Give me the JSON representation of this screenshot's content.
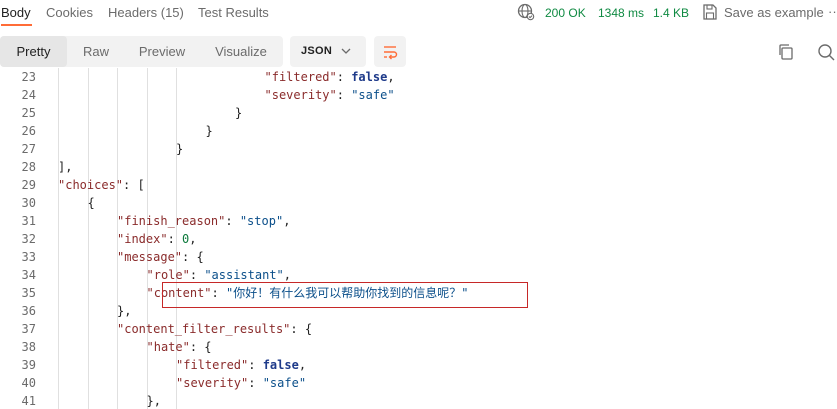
{
  "tabs": [
    {
      "label": "Body",
      "active": true
    },
    {
      "label": "Cookies",
      "active": false
    },
    {
      "label": "Headers (15)",
      "active": false
    },
    {
      "label": "Test Results",
      "active": false
    }
  ],
  "status": {
    "code": "200 OK",
    "time": "1348 ms",
    "size": "1.4 KB",
    "save_label": "Save as example",
    "more": "··"
  },
  "view_modes": [
    {
      "label": "Pretty",
      "active": true
    },
    {
      "label": "Raw",
      "active": false
    },
    {
      "label": "Preview",
      "active": false
    },
    {
      "label": "Visualize",
      "active": false
    }
  ],
  "format": "JSON",
  "colors": {
    "accent": "#ff6c37",
    "status_ok": "#0f8a42",
    "highlight_box": "#c62828"
  },
  "icons": [
    "globe-icon",
    "save-icon",
    "chevron-down-icon",
    "wrap-lines-icon",
    "copy-icon",
    "search-icon"
  ],
  "code_lines": [
    {
      "num": "23",
      "tokens": [
        {
          "t": "k",
          "v": "\"filtered\""
        },
        {
          "t": "p",
          "v": ": "
        },
        {
          "t": "b",
          "v": "false"
        },
        {
          "t": "p",
          "v": ","
        }
      ],
      "indent": 7
    },
    {
      "num": "24",
      "tokens": [
        {
          "t": "k",
          "v": "\"severity\""
        },
        {
          "t": "p",
          "v": ": "
        },
        {
          "t": "s",
          "v": "\"safe\""
        }
      ],
      "indent": 7
    },
    {
      "num": "25",
      "tokens": [
        {
          "t": "p",
          "v": "}"
        }
      ],
      "indent": 6
    },
    {
      "num": "26",
      "tokens": [
        {
          "t": "p",
          "v": "}"
        }
      ],
      "indent": 5
    },
    {
      "num": "27",
      "tokens": [
        {
          "t": "p",
          "v": "}"
        }
      ],
      "indent": 4
    },
    {
      "num": "28",
      "tokens": [
        {
          "t": "p",
          "v": "],"
        }
      ],
      "indent": 0
    },
    {
      "num": "29",
      "tokens": [
        {
          "t": "k",
          "v": "\"choices\""
        },
        {
          "t": "p",
          "v": ": ["
        }
      ],
      "indent": 0
    },
    {
      "num": "30",
      "tokens": [
        {
          "t": "p",
          "v": "{"
        }
      ],
      "indent": 1
    },
    {
      "num": "31",
      "tokens": [
        {
          "t": "k",
          "v": "\"finish_reason\""
        },
        {
          "t": "p",
          "v": ": "
        },
        {
          "t": "s",
          "v": "\"stop\""
        },
        {
          "t": "p",
          "v": ","
        }
      ],
      "indent": 2
    },
    {
      "num": "32",
      "tokens": [
        {
          "t": "k",
          "v": "\"index\""
        },
        {
          "t": "p",
          "v": ": "
        },
        {
          "t": "n",
          "v": "0"
        },
        {
          "t": "p",
          "v": ","
        }
      ],
      "indent": 2
    },
    {
      "num": "33",
      "tokens": [
        {
          "t": "k",
          "v": "\"message\""
        },
        {
          "t": "p",
          "v": ": {"
        }
      ],
      "indent": 2
    },
    {
      "num": "34",
      "tokens": [
        {
          "t": "k",
          "v": "\"role\""
        },
        {
          "t": "p",
          "v": ": "
        },
        {
          "t": "s",
          "v": "\"assistant\""
        },
        {
          "t": "p",
          "v": ","
        }
      ],
      "indent": 3
    },
    {
      "num": "35",
      "tokens": [
        {
          "t": "k",
          "v": "\"content\""
        },
        {
          "t": "p",
          "v": ": "
        },
        {
          "t": "s",
          "v": "\"你好！有什么我可以帮助你找到的信息呢？\""
        }
      ],
      "indent": 3
    },
    {
      "num": "36",
      "tokens": [
        {
          "t": "p",
          "v": "},"
        }
      ],
      "indent": 2
    },
    {
      "num": "37",
      "tokens": [
        {
          "t": "k",
          "v": "\"content_filter_results\""
        },
        {
          "t": "p",
          "v": ": {"
        }
      ],
      "indent": 2
    },
    {
      "num": "38",
      "tokens": [
        {
          "t": "k",
          "v": "\"hate\""
        },
        {
          "t": "p",
          "v": ": {"
        }
      ],
      "indent": 3
    },
    {
      "num": "39",
      "tokens": [
        {
          "t": "k",
          "v": "\"filtered\""
        },
        {
          "t": "p",
          "v": ": "
        },
        {
          "t": "b",
          "v": "false"
        },
        {
          "t": "p",
          "v": ","
        }
      ],
      "indent": 4
    },
    {
      "num": "40",
      "tokens": [
        {
          "t": "k",
          "v": "\"severity\""
        },
        {
          "t": "p",
          "v": ": "
        },
        {
          "t": "s",
          "v": "\"safe\""
        }
      ],
      "indent": 4
    },
    {
      "num": "41",
      "tokens": [
        {
          "t": "p",
          "v": "},"
        }
      ],
      "indent": 3
    }
  ]
}
